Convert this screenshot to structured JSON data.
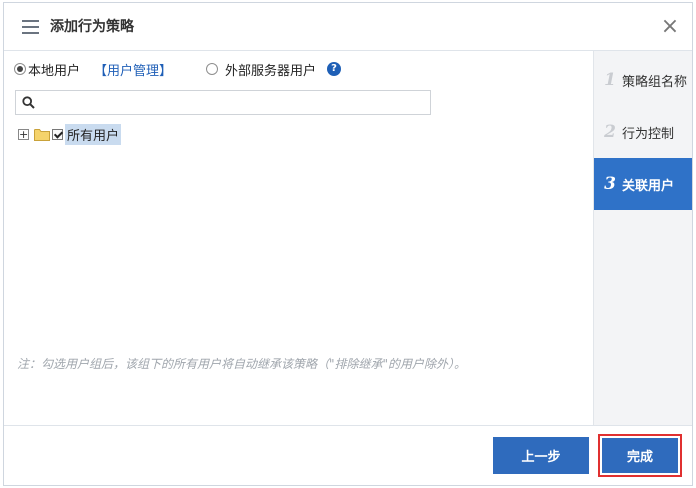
{
  "dialog": {
    "title": "添加行为策略",
    "close_glyph": "×"
  },
  "source": {
    "local_user_label": "本地用户",
    "local_user_selected": true,
    "user_mgmt_link": "【用户管理】",
    "external_label": "外部服务器用户",
    "external_selected": false,
    "help_glyph": "?"
  },
  "search": {
    "value": "",
    "placeholder": ""
  },
  "tree": {
    "expander": "+",
    "root_label": "所有用户",
    "root_checked": true
  },
  "note": "注：勾选用户组后，该组下的所有用户将自动继承该策略（\"排除继承\"的用户除外）。",
  "steps": [
    {
      "num": "1",
      "label": "策略组名称",
      "active": false
    },
    {
      "num": "2",
      "label": "行为控制",
      "active": false
    },
    {
      "num": "3",
      "label": "关联用户",
      "active": true
    }
  ],
  "footer": {
    "prev_label": "上一步",
    "done_label": "完成"
  },
  "colors": {
    "accent": "#2f6bbd",
    "active_step": "#2f72c8",
    "highlight_border": "#e03030",
    "link": "#1f5fb7"
  }
}
